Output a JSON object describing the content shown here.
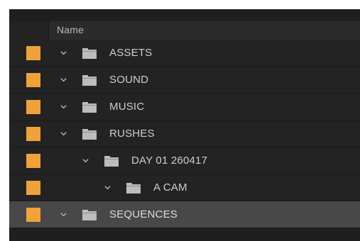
{
  "header": {
    "name_label": "Name"
  },
  "label_color": "#f0a23a",
  "rows": [
    {
      "label": "ASSETS",
      "depth": 0,
      "expanded": true,
      "icon": "folder-icon",
      "selected": false
    },
    {
      "label": "SOUND",
      "depth": 0,
      "expanded": true,
      "icon": "folder-icon",
      "selected": false
    },
    {
      "label": "MUSIC",
      "depth": 0,
      "expanded": true,
      "icon": "folder-icon",
      "selected": false
    },
    {
      "label": "RUSHES",
      "depth": 0,
      "expanded": true,
      "icon": "folder-icon",
      "selected": false
    },
    {
      "label": "DAY 01 260417",
      "depth": 1,
      "expanded": true,
      "icon": "folder-icon",
      "selected": false
    },
    {
      "label": "A CAM",
      "depth": 2,
      "expanded": true,
      "icon": "folder-icon",
      "selected": false
    },
    {
      "label": "SEQUENCES",
      "depth": 0,
      "expanded": true,
      "icon": "folder-icon",
      "selected": true
    }
  ]
}
